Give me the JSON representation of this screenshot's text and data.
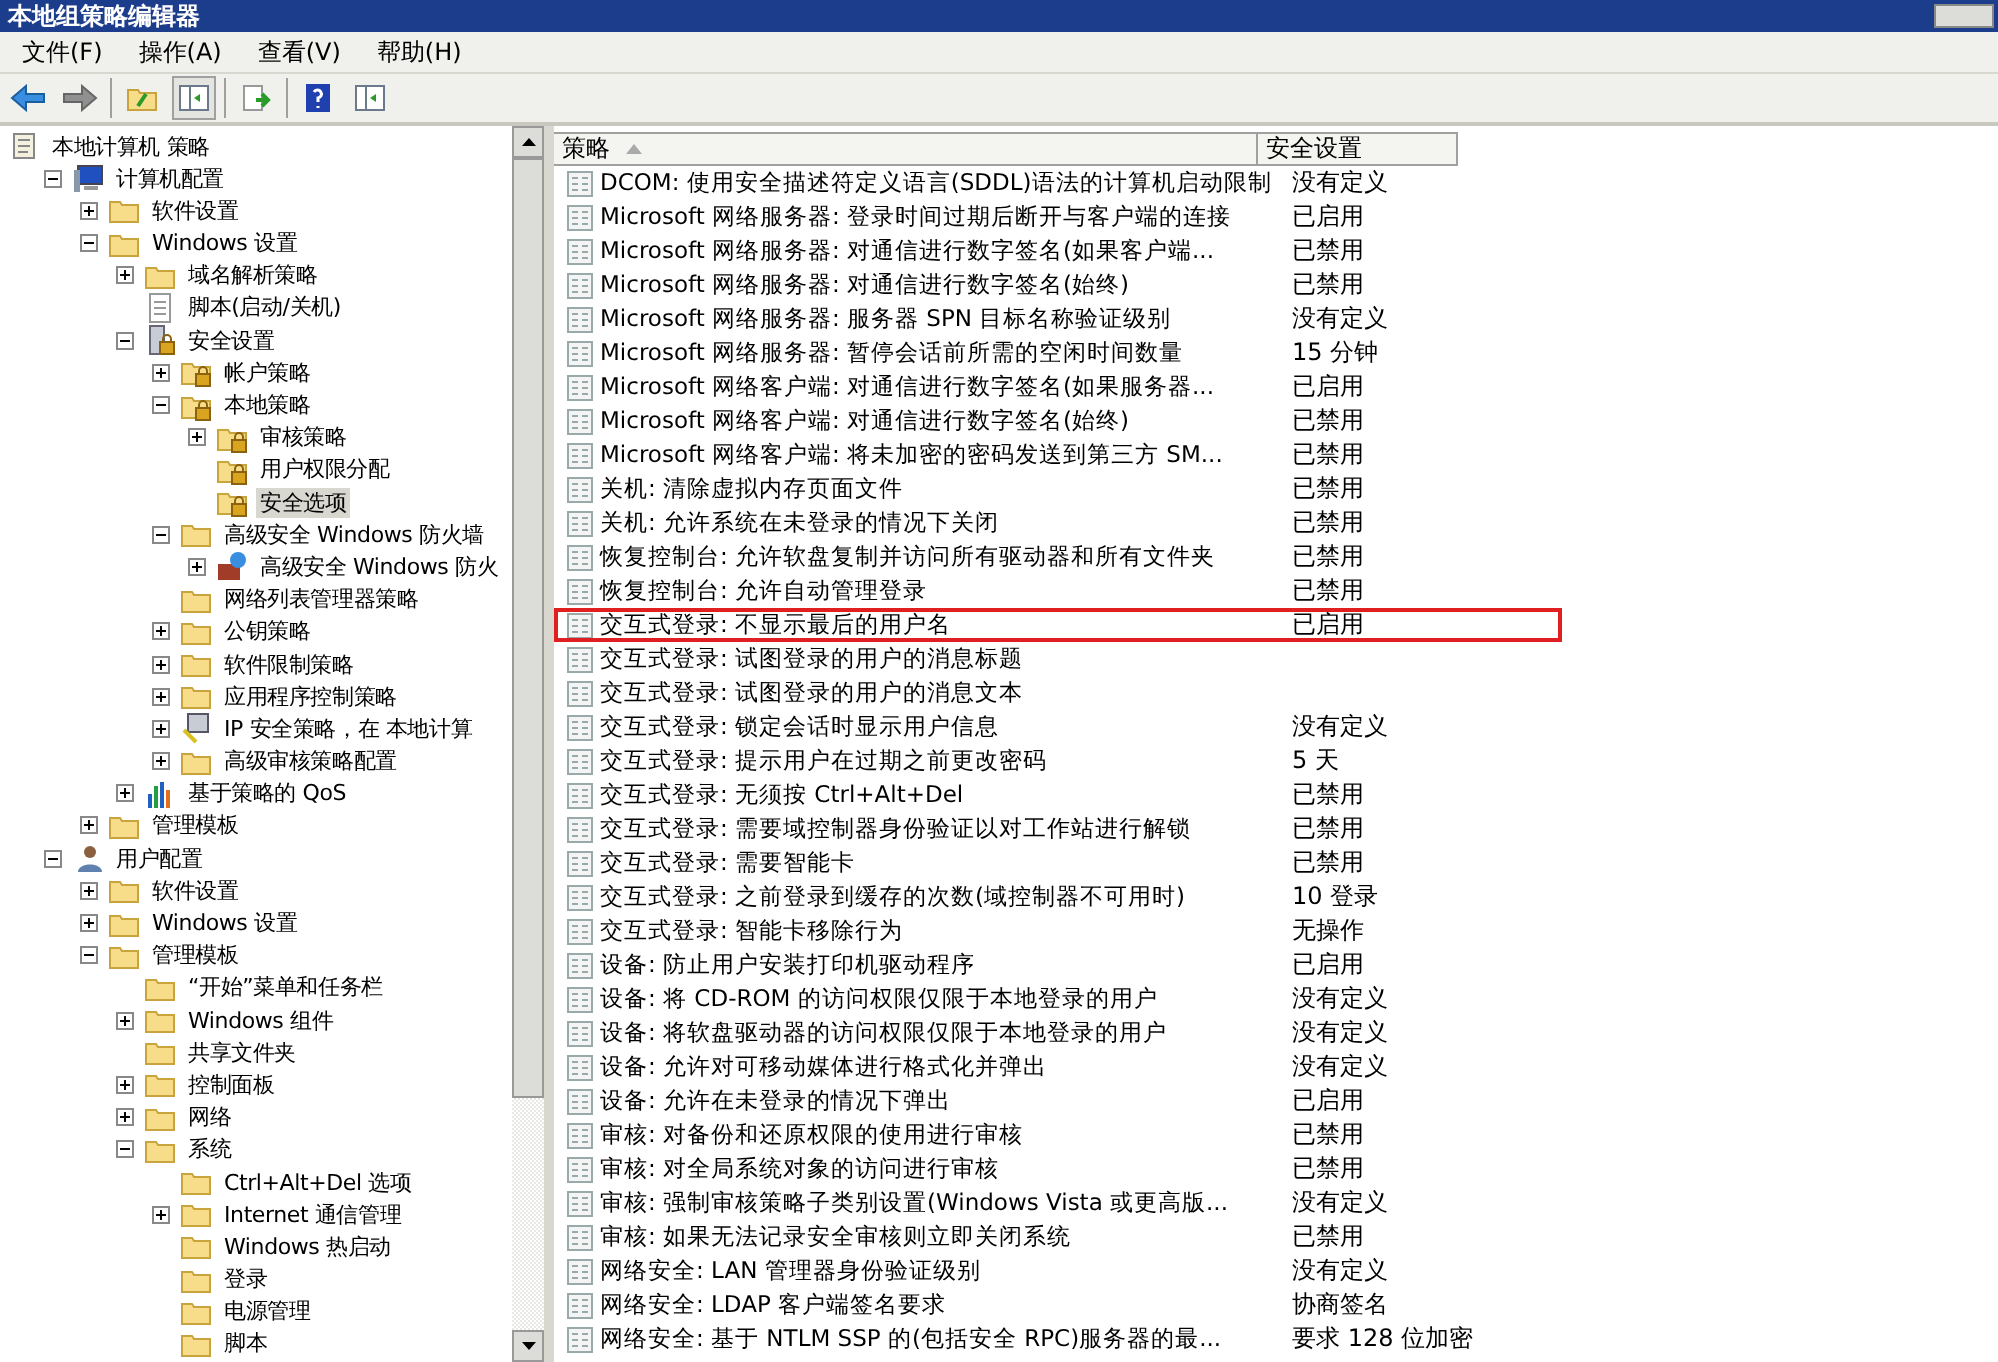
{
  "window": {
    "title": "本地组策略编辑器"
  },
  "menu": [
    "文件(F)",
    "操作(A)",
    "查看(V)",
    "帮助(H)"
  ],
  "toolbar": [
    {
      "kind": "back"
    },
    {
      "kind": "forward"
    },
    {
      "kind": "sep"
    },
    {
      "kind": "up"
    },
    {
      "kind": "pane",
      "selected": true
    },
    {
      "kind": "sep"
    },
    {
      "kind": "export"
    },
    {
      "kind": "sep"
    },
    {
      "kind": "help"
    },
    {
      "kind": "pane",
      "selected": false
    }
  ],
  "tree": [
    {
      "label": "本地计算机 策略",
      "kind": "doc",
      "selected": false,
      "children": [
        {
          "label": "计算机配置",
          "kind": "computer",
          "expanded": true,
          "selected": false,
          "children": [
            {
              "label": "软件设置",
              "kind": "folder",
              "expanded": false,
              "selected": false
            },
            {
              "label": "Windows 设置",
              "kind": "folder",
              "expanded": true,
              "selected": false,
              "children": [
                {
                  "label": "域名解析策略",
                  "kind": "folder",
                  "expanded": false,
                  "selected": false
                },
                {
                  "label": "脚本(启动/关机)",
                  "kind": "script",
                  "selected": false
                },
                {
                  "label": "安全设置",
                  "kind": "server",
                  "expanded": true,
                  "selected": false,
                  "children": [
                    {
                      "label": "帐户策略",
                      "kind": "lock",
                      "expanded": false,
                      "selected": false
                    },
                    {
                      "label": "本地策略",
                      "kind": "lock",
                      "expanded": true,
                      "selected": false,
                      "children": [
                        {
                          "label": "审核策略",
                          "kind": "lock",
                          "expanded": false,
                          "selected": false
                        },
                        {
                          "label": "用户权限分配",
                          "kind": "lock",
                          "selected": false
                        },
                        {
                          "label": "安全选项",
                          "kind": "lock",
                          "selected": true
                        }
                      ]
                    },
                    {
                      "label": "高级安全 Windows 防火墙",
                      "kind": "folder",
                      "expanded": true,
                      "selected": false,
                      "children": [
                        {
                          "label": "高级安全 Windows 防火",
                          "kind": "firewall",
                          "expanded": false,
                          "selected": false
                        }
                      ]
                    },
                    {
                      "label": "网络列表管理器策略",
                      "kind": "folder",
                      "selected": false
                    },
                    {
                      "label": "公钥策略",
                      "kind": "folder",
                      "expanded": false,
                      "selected": false
                    },
                    {
                      "label": "软件限制策略",
                      "kind": "folder",
                      "expanded": false,
                      "selected": false
                    },
                    {
                      "label": "应用程序控制策略",
                      "kind": "folder",
                      "expanded": false,
                      "selected": false
                    },
                    {
                      "label": "IP 安全策略，在 本地计算",
                      "kind": "ip",
                      "expanded": false,
                      "selected": false
                    },
                    {
                      "label": "高级审核策略配置",
                      "kind": "folder",
                      "expanded": false,
                      "selected": false
                    }
                  ]
                },
                {
                  "label": "基于策略的 QoS",
                  "kind": "qos",
                  "expanded": false,
                  "selected": false
                }
              ]
            },
            {
              "label": "管理模板",
              "kind": "folder",
              "expanded": false,
              "selected": false
            }
          ]
        },
        {
          "label": "用户配置",
          "kind": "user",
          "expanded": true,
          "selected": false,
          "children": [
            {
              "label": "软件设置",
              "kind": "folder",
              "expanded": false,
              "selected": false
            },
            {
              "label": "Windows 设置",
              "kind": "folder",
              "expanded": false,
              "selected": false
            },
            {
              "label": "管理模板",
              "kind": "folder",
              "expanded": true,
              "selected": false,
              "children": [
                {
                  "label": "“开始”菜单和任务栏",
                  "kind": "folder",
                  "selected": false
                },
                {
                  "label": "Windows 组件",
                  "kind": "folder",
                  "expanded": false,
                  "selected": false
                },
                {
                  "label": "共享文件夹",
                  "kind": "folder",
                  "selected": false
                },
                {
                  "label": "控制面板",
                  "kind": "folder",
                  "expanded": false,
                  "selected": false
                },
                {
                  "label": "网络",
                  "kind": "folder",
                  "expanded": false,
                  "selected": false
                },
                {
                  "label": "系统",
                  "kind": "folder",
                  "expanded": true,
                  "selected": false,
                  "children": [
                    {
                      "label": "Ctrl+Alt+Del 选项",
                      "kind": "folder",
                      "selected": false
                    },
                    {
                      "label": "Internet 通信管理",
                      "kind": "folder",
                      "expanded": false,
                      "selected": false
                    },
                    {
                      "label": "Windows 热启动",
                      "kind": "folder",
                      "selected": false
                    },
                    {
                      "label": "登录",
                      "kind": "folder",
                      "selected": false
                    },
                    {
                      "label": "电源管理",
                      "kind": "folder",
                      "selected": false
                    },
                    {
                      "label": "脚本",
                      "kind": "folder",
                      "selected": false
                    }
                  ]
                }
              ]
            }
          ]
        }
      ]
    }
  ],
  "table": {
    "columns": [
      "策略",
      "安全设置"
    ],
    "rows": [
      {
        "policy": "DCOM: 使用安全描述符定义语言(SDDL)语法的计算机启动限制",
        "setting": "没有定义",
        "highlighted": false
      },
      {
        "policy": "Microsoft 网络服务器: 登录时间过期后断开与客户端的连接",
        "setting": "已启用",
        "highlighted": false
      },
      {
        "policy": "Microsoft 网络服务器: 对通信进行数字签名(如果客户端...",
        "setting": "已禁用",
        "highlighted": false
      },
      {
        "policy": "Microsoft 网络服务器: 对通信进行数字签名(始终)",
        "setting": "已禁用",
        "highlighted": false
      },
      {
        "policy": "Microsoft 网络服务器: 服务器 SPN 目标名称验证级别",
        "setting": "没有定义",
        "highlighted": false
      },
      {
        "policy": "Microsoft 网络服务器: 暂停会话前所需的空闲时间数量",
        "setting": "15 分钟",
        "highlighted": false
      },
      {
        "policy": "Microsoft 网络客户端: 对通信进行数字签名(如果服务器...",
        "setting": "已启用",
        "highlighted": false
      },
      {
        "policy": "Microsoft 网络客户端: 对通信进行数字签名(始终)",
        "setting": "已禁用",
        "highlighted": false
      },
      {
        "policy": "Microsoft 网络客户端: 将未加密的密码发送到第三方 SM...",
        "setting": "已禁用",
        "highlighted": false
      },
      {
        "policy": "关机: 清除虚拟内存页面文件",
        "setting": "已禁用",
        "highlighted": false
      },
      {
        "policy": "关机: 允许系统在未登录的情况下关闭",
        "setting": "已禁用",
        "highlighted": false
      },
      {
        "policy": "恢复控制台: 允许软盘复制并访问所有驱动器和所有文件夹",
        "setting": "已禁用",
        "highlighted": false
      },
      {
        "policy": "恢复控制台: 允许自动管理登录",
        "setting": "已禁用",
        "highlighted": false
      },
      {
        "policy": "交互式登录: 不显示最后的用户名",
        "setting": "已启用",
        "highlighted": true
      },
      {
        "policy": "交互式登录: 试图登录的用户的消息标题",
        "highlighted": false
      },
      {
        "policy": "交互式登录: 试图登录的用户的消息文本",
        "highlighted": false
      },
      {
        "policy": "交互式登录: 锁定会话时显示用户信息",
        "setting": "没有定义",
        "highlighted": false
      },
      {
        "policy": "交互式登录: 提示用户在过期之前更改密码",
        "setting": "5 天",
        "highlighted": false
      },
      {
        "policy": "交互式登录: 无须按 Ctrl+Alt+Del",
        "setting": "已禁用",
        "highlighted": false
      },
      {
        "policy": "交互式登录: 需要域控制器身份验证以对工作站进行解锁",
        "setting": "已禁用",
        "highlighted": false
      },
      {
        "policy": "交互式登录: 需要智能卡",
        "setting": "已禁用",
        "highlighted": false
      },
      {
        "policy": "交互式登录: 之前登录到缓存的次数(域控制器不可用时)",
        "setting": "10 登录",
        "highlighted": false
      },
      {
        "policy": "交互式登录: 智能卡移除行为",
        "setting": "无操作",
        "highlighted": false
      },
      {
        "policy": "设备: 防止用户安装打印机驱动程序",
        "setting": "已启用",
        "highlighted": false
      },
      {
        "policy": "设备: 将 CD-ROM 的访问权限仅限于本地登录的用户",
        "setting": "没有定义",
        "highlighted": false
      },
      {
        "policy": "设备: 将软盘驱动器的访问权限仅限于本地登录的用户",
        "setting": "没有定义",
        "highlighted": false
      },
      {
        "policy": "设备: 允许对可移动媒体进行格式化并弹出",
        "setting": "没有定义",
        "highlighted": false
      },
      {
        "policy": "设备: 允许在未登录的情况下弹出",
        "setting": "已启用",
        "highlighted": false
      },
      {
        "policy": "审核: 对备份和还原权限的使用进行审核",
        "setting": "已禁用",
        "highlighted": false
      },
      {
        "policy": "审核: 对全局系统对象的访问进行审核",
        "setting": "已禁用",
        "highlighted": false
      },
      {
        "policy": "审核: 强制审核策略子类别设置(Windows Vista 或更高版...",
        "setting": "没有定义",
        "highlighted": false
      },
      {
        "policy": "审核: 如果无法记录安全审核则立即关闭系统",
        "setting": "已禁用",
        "highlighted": false
      },
      {
        "policy": "网络安全: LAN 管理器身份验证级别",
        "setting": "没有定义",
        "highlighted": false
      },
      {
        "policy": "网络安全: LDAP 客户端签名要求",
        "setting": "协商签名",
        "highlighted": false
      },
      {
        "policy": "网络安全: 基于 NTLM SSP 的(包括安全 RPC)服务器的最...",
        "setting": "要求 128 位加密",
        "highlighted": false
      }
    ]
  }
}
